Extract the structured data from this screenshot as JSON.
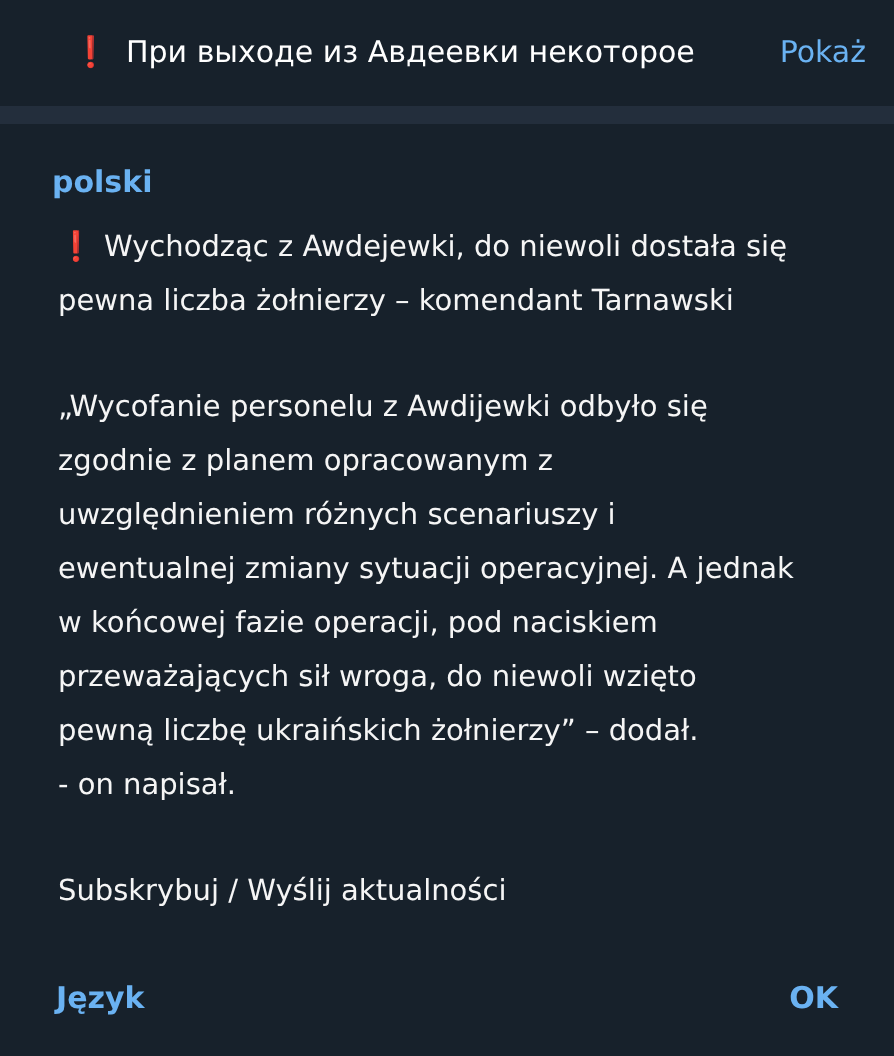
{
  "header": {
    "icon": "❗",
    "title": "При выходе из Авдеевки некоторое",
    "action": "Pokaż"
  },
  "dialog": {
    "language": "polski",
    "paragraphs": [
      {
        "icon": "❗",
        "text": "Wychodząc z Awdejewki, do niewoli dostała się\npewna liczba żołnierzy – komendant Tarnawski"
      },
      {
        "text": " „Wycofanie personelu z Awdijewki odbyło się\nzgodnie z planem opracowanym z\nuwzględnieniem różnych scenariuszy i\newentualnej zmiany sytuacji operacyjnej. A jednak\nw końcowej fazie operacji, pod naciskiem\nprzeważających sił wroga, do niewoli wzięto\npewną liczbę ukraińskich żołnierzy” – dodał.\n- on napisał."
      },
      {
        "text": "Subskrybuj / Wyślij aktualności"
      }
    ],
    "buttons": [
      "Język",
      "OK"
    ]
  }
}
